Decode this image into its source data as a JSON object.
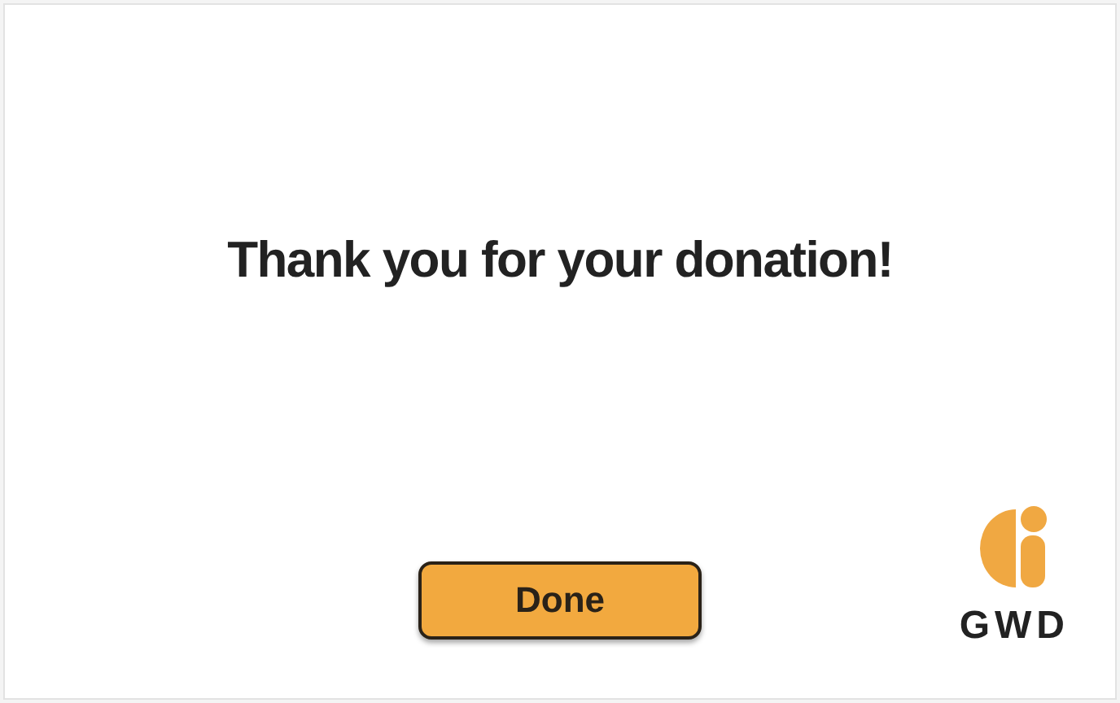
{
  "message": {
    "title": "Thank you for your donation!"
  },
  "button": {
    "label": "Done"
  },
  "logo": {
    "text": "GWD"
  }
}
